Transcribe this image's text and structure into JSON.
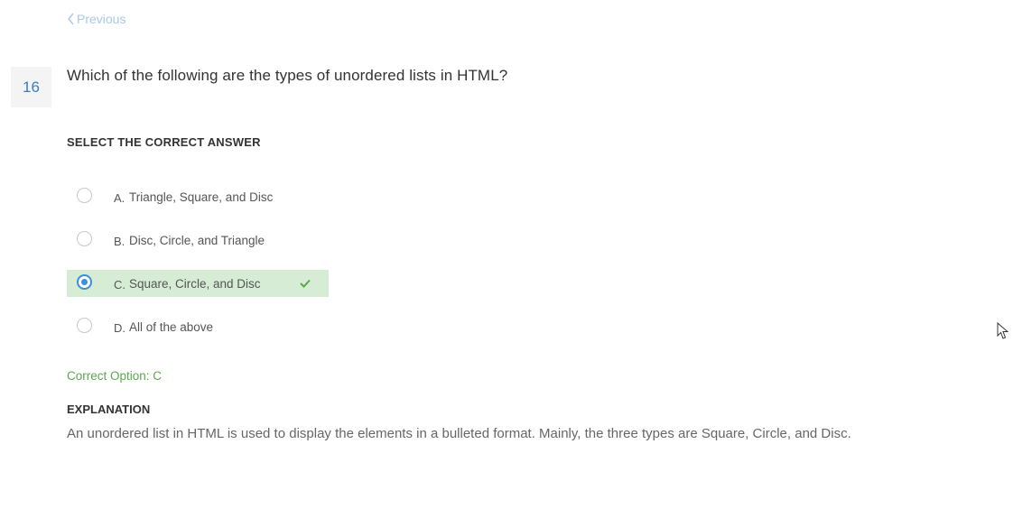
{
  "nav": {
    "previous_label": "Previous"
  },
  "question": {
    "number": "16",
    "text": "Which of the following are the types of unordered lists in HTML?"
  },
  "answer_section": {
    "heading": "SELECT THE CORRECT ANSWER",
    "options": [
      {
        "letter": "A.",
        "text": "Triangle, Square, and Disc",
        "selected": false,
        "correct": false
      },
      {
        "letter": "B.",
        "text": "Disc, Circle, and Triangle",
        "selected": false,
        "correct": false
      },
      {
        "letter": "C.",
        "text": "Square, Circle, and Disc",
        "selected": true,
        "correct": true
      },
      {
        "letter": "D.",
        "text": "All of the above",
        "selected": false,
        "correct": false
      }
    ]
  },
  "result": {
    "correct_option_text": "Correct Option: C"
  },
  "explanation": {
    "heading": "EXPLANATION",
    "text": "An unordered list in HTML is used to display the elements in a bulleted format. Mainly, the three types are Square, Circle, and Disc."
  },
  "colors": {
    "link": "#a9c9e8",
    "question_number": "#3a7cc7",
    "correct_highlight": "#d6ecd4",
    "correct_text": "#5aa84c",
    "radio_checked": "#3a8fd9"
  },
  "icons": {
    "previous": "chevron-left-icon",
    "correct_mark": "checkmark-icon",
    "pointer": "mouse-cursor-icon"
  }
}
